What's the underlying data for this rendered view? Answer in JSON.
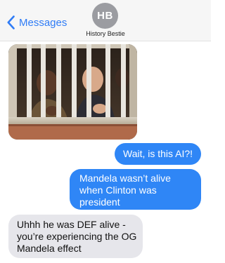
{
  "header": {
    "back_label": "Messages",
    "avatar_initials": "HB",
    "contact_name": "History Bestie"
  },
  "conversation": {
    "photo": {
      "description_icon": "photo-attachment"
    },
    "messages": [
      {
        "from": "me",
        "text": "Wait, is this AI?!"
      },
      {
        "from": "me",
        "text": "Mandela wasn’t alive when Clinton was president"
      },
      {
        "from": "them",
        "text": "Uhhh he was DEF alive - you’re experiencing the OG Mandela effect"
      }
    ]
  },
  "colors": {
    "accent": "#2f7cf6",
    "sent_bubble": "#2f86f6",
    "received_bubble": "#e6e6eb",
    "header_bg": "#f6f6f6",
    "avatar_bg": "#9b9ca1"
  }
}
